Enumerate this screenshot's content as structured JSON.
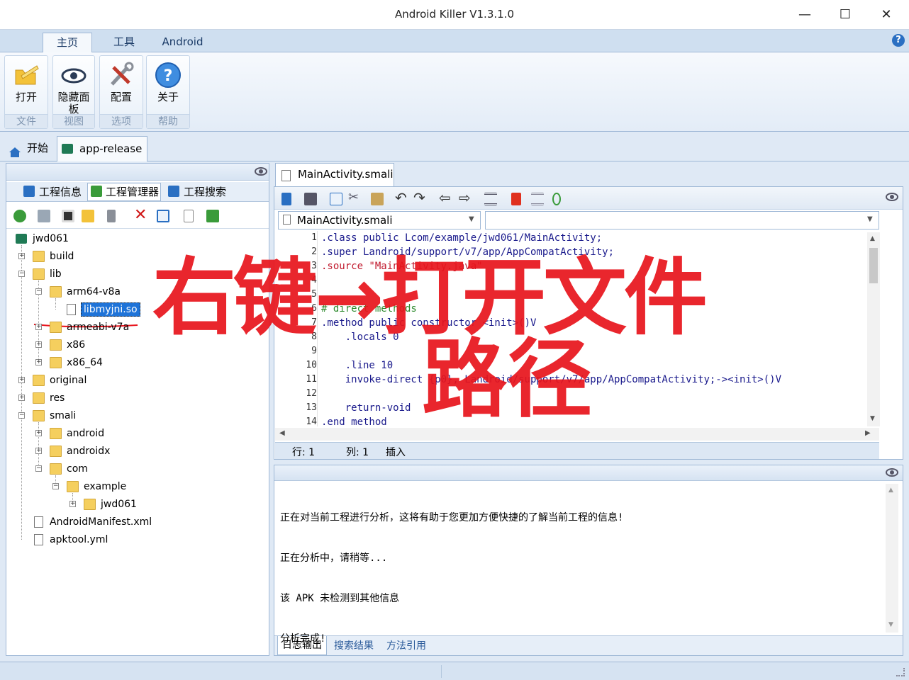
{
  "window": {
    "title": "Android Killer V1.3.1.0",
    "minimize": "—",
    "maximize": "☐",
    "close": "✕"
  },
  "ribbon_tabs": [
    "主页",
    "工具",
    "Android"
  ],
  "ribbon_groups": [
    {
      "button": "打开",
      "group": "文件",
      "icon": "open-folder-icon"
    },
    {
      "button": "隐藏面板",
      "group": "视图",
      "icon": "eye-icon"
    },
    {
      "button": "配置",
      "group": "选项",
      "icon": "tools-icon"
    },
    {
      "button": "关于",
      "group": "帮助",
      "icon": "help-icon"
    }
  ],
  "doc_tabs": [
    "开始",
    "app-release"
  ],
  "left_tabs": [
    "工程信息",
    "工程管理器",
    "工程搜索"
  ],
  "tree": [
    {
      "label": "jwd061"
    },
    {
      "label": "build"
    },
    {
      "label": "lib"
    },
    {
      "label": "arm64-v8a"
    },
    {
      "label": "libmyjni.so"
    },
    {
      "label": "armeabi-v7a"
    },
    {
      "label": "x86"
    },
    {
      "label": "x86_64"
    },
    {
      "label": "original"
    },
    {
      "label": "res"
    },
    {
      "label": "smali"
    },
    {
      "label": "android"
    },
    {
      "label": "androidx"
    },
    {
      "label": "com"
    },
    {
      "label": "example"
    },
    {
      "label": "jwd061"
    },
    {
      "label": "AndroidManifest.xml"
    },
    {
      "label": "apktool.yml"
    }
  ],
  "editor": {
    "tab": "MainActivity.smali",
    "file_combo": "MainActivity.smali",
    "method_combo": "",
    "lines": [
      {
        "n": "1",
        "text": ".class public Lcom/example/jwd061/MainActivity;"
      },
      {
        "n": "2",
        "text": ".super Landroid/support/v7/app/AppCompatActivity;"
      },
      {
        "n": "3",
        "text": ".source \"MainActivity.java\""
      },
      {
        "n": "4",
        "text": ""
      },
      {
        "n": "5",
        "text": ""
      },
      {
        "n": "6",
        "text": "# direct methods"
      },
      {
        "n": "7",
        "text": ".method public constructor <init>()V"
      },
      {
        "n": "8",
        "text": "    .locals 0"
      },
      {
        "n": "9",
        "text": ""
      },
      {
        "n": "10",
        "text": "    .line 10"
      },
      {
        "n": "11",
        "text": "    invoke-direct {p0}, Landroid/support/v7/app/AppCompatActivity;-><init>()V"
      },
      {
        "n": "12",
        "text": ""
      },
      {
        "n": "13",
        "text": "    return-void"
      },
      {
        "n": "14",
        "text": ".end method"
      }
    ],
    "status": {
      "row": "行: 1",
      "col": "列: 1",
      "mode": "插入"
    }
  },
  "log": {
    "lines": [
      "正在对当前工程进行分析，这将有助于您更加方便快捷的了解当前工程的信息!",
      "正在分析中，请稍等...",
      "该 APK 未检测到其他信息",
      "分析完成!"
    ],
    "tabs": [
      "日志输出",
      "搜索结果",
      "方法引用"
    ]
  },
  "annotation": {
    "line1": "右键→打开文件",
    "line2": "路径",
    "color": "#e8141c"
  }
}
